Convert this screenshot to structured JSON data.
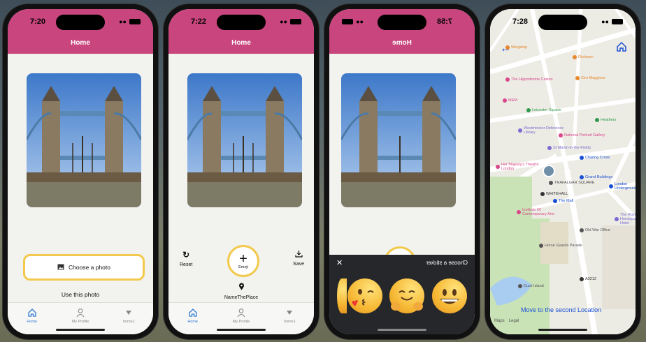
{
  "theme": {
    "header_color": "#c8457d",
    "accent_yellow": "#f2c94c",
    "tab_active": "#2f7bd3",
    "map_link": "#1a4fd6"
  },
  "phone1": {
    "time": "7:20",
    "header_title": "Home",
    "choose_photo_label": "Choose a photo",
    "use_photo_label": "Use this photo",
    "tabs": [
      {
        "label": "Home",
        "icon": "house-icon"
      },
      {
        "label": "My Profile",
        "icon": "person-icon"
      },
      {
        "label": "home1",
        "icon": "triangle-down-icon"
      }
    ]
  },
  "phone2": {
    "time": "7:22",
    "header_title": "Home",
    "reset_label": "Reset",
    "emoji_label": "Emoji",
    "save_label": "Save",
    "place_label": "NameThePlace",
    "tabs": [
      {
        "label": "Home",
        "icon": "house-icon"
      },
      {
        "label": "My Profile",
        "icon": "person-icon"
      },
      {
        "label": "home1",
        "icon": "triangle-down-icon"
      }
    ]
  },
  "phone3": {
    "time": "7:58",
    "header_title": "Home",
    "sheet_title": "Choose a sticker",
    "stickers": [
      "kissing-face-emoji",
      "hugging-face-emoji",
      "grinning-face-emoji"
    ]
  },
  "phone4": {
    "time": "7:28",
    "link_label": "Move to the second Location",
    "maps_brand": "Maps",
    "legal": "Legal",
    "poi": [
      {
        "label": "Wingstop",
        "color": "#e8872b"
      },
      {
        "label": "Dishoom",
        "color": "#e8872b"
      },
      {
        "label": "The Hippodrome Casino",
        "color": "#d9478a"
      },
      {
        "label": "Ciro Maggiore",
        "color": "#e8872b"
      },
      {
        "label": "M&M",
        "color": "#d9478a"
      },
      {
        "label": "Leicester Square",
        "color": "#2f9a4c"
      },
      {
        "label": "Heathers",
        "color": "#2f9a4c"
      },
      {
        "label": "Westminster Reference Library",
        "color": "#7a6bd3"
      },
      {
        "label": "National Portrait Gallery",
        "color": "#d9478a"
      },
      {
        "label": "St Martin-in-the-Fields",
        "color": "#7a6bd3"
      },
      {
        "label": "Charing Cross",
        "color": "#1a4fd6"
      },
      {
        "label": "Her Majesty's Theatre London",
        "color": "#d9478a"
      },
      {
        "label": "TRAFALGAR SQUARE",
        "color": "#555555"
      },
      {
        "label": "Grand Buildings",
        "color": "#1a4fd6"
      },
      {
        "label": "London Underground",
        "color": "#1a4fd6"
      },
      {
        "label": "WHITEHALL",
        "color": "#333333"
      },
      {
        "label": "The Mall",
        "color": "#1a4fd6"
      },
      {
        "label": "Institute Of Contemporary Arts",
        "color": "#d9478a"
      },
      {
        "label": "Old War Office",
        "color": "#555555"
      },
      {
        "label": "The Royal Horseguards Hotel",
        "color": "#7a6bd3"
      },
      {
        "label": "Horse Guards Parade",
        "color": "#555555"
      },
      {
        "label": "Duck Island",
        "color": "#555555"
      },
      {
        "label": "A3212",
        "color": "#333333"
      }
    ]
  }
}
